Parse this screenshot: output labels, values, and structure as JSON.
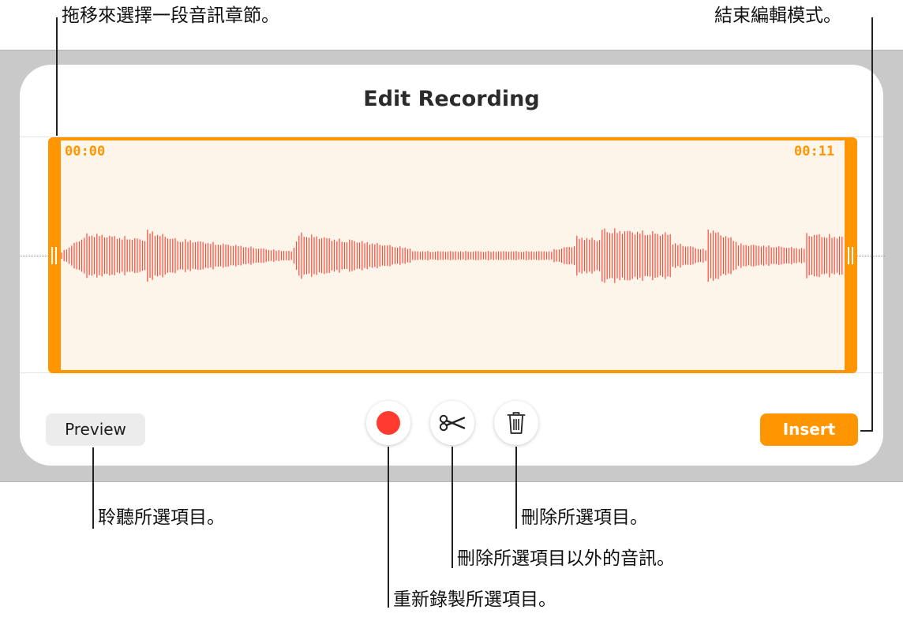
{
  "dialog": {
    "title": "Edit Recording",
    "start_time": "00:00",
    "end_time": "00:11",
    "preview_label": "Preview",
    "insert_label": "Insert"
  },
  "toolbar": {
    "record_icon": "record-icon",
    "trim_icon": "scissors-icon",
    "delete_icon": "trash-icon"
  },
  "callouts": {
    "drag_select": "拖移來選擇一段音訊章節。",
    "end_edit": "結束編輯模式。",
    "preview": "聆聽所選項目。",
    "delete": "刪除所選項目。",
    "trim": "刪除所選項目以外的音訊。",
    "rerecord": "重新錄製所選項目。"
  },
  "colors": {
    "accent": "#ff9500",
    "record": "#ff3b30",
    "waveform": "#ff4a3d",
    "selection_fill": "#fdf4ea"
  }
}
